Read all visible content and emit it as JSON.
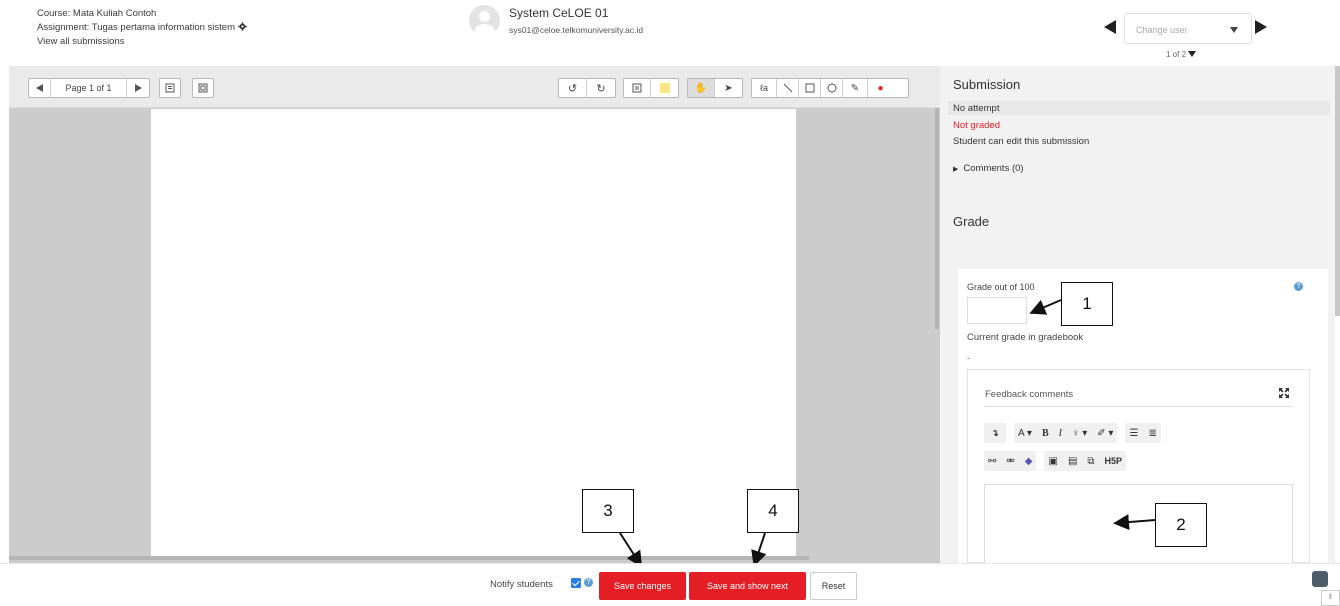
{
  "header": {
    "course": "Course: Mata Kuliah Contoh",
    "assignment": "Assignment: Tugas pertama information sistem",
    "view_all": "View all submissions",
    "user_name": "System CeLOE 01",
    "user_email": "sys01@celoe.telkomuniversity.ac.id",
    "change_user_placeholder": "Change user",
    "user_count": "1 of 2"
  },
  "editor_toolbar": {
    "page_label": "Page 1 of 1",
    "annotation_color": "#ffe484",
    "stamp_color": "#e51e25"
  },
  "panel": {
    "submission_title": "Submission",
    "status": "No attempt",
    "grading_status": "Not graded",
    "edit_note": "Student can edit this submission",
    "comments": "Comments (0)",
    "grade_title": "Grade",
    "grade_label": "Grade out of 100",
    "grade_value": "",
    "current_grade_label": "Current grade in gradebook",
    "current_grade_value": "-",
    "feedback_label": "Feedback comments",
    "editor_row1": [
      "A",
      "B",
      "I"
    ],
    "h5p_label": "H5P"
  },
  "callouts": [
    "1",
    "2",
    "3",
    "4"
  ],
  "footer": {
    "notify_label": "Notify students",
    "save_label": "Save changes",
    "save_next_label": "Save and show next",
    "reset_label": "Reset"
  },
  "colors": {
    "accent_red": "#e51e25",
    "not_graded": "#e51e25",
    "link_blue": "#2d7be5"
  }
}
